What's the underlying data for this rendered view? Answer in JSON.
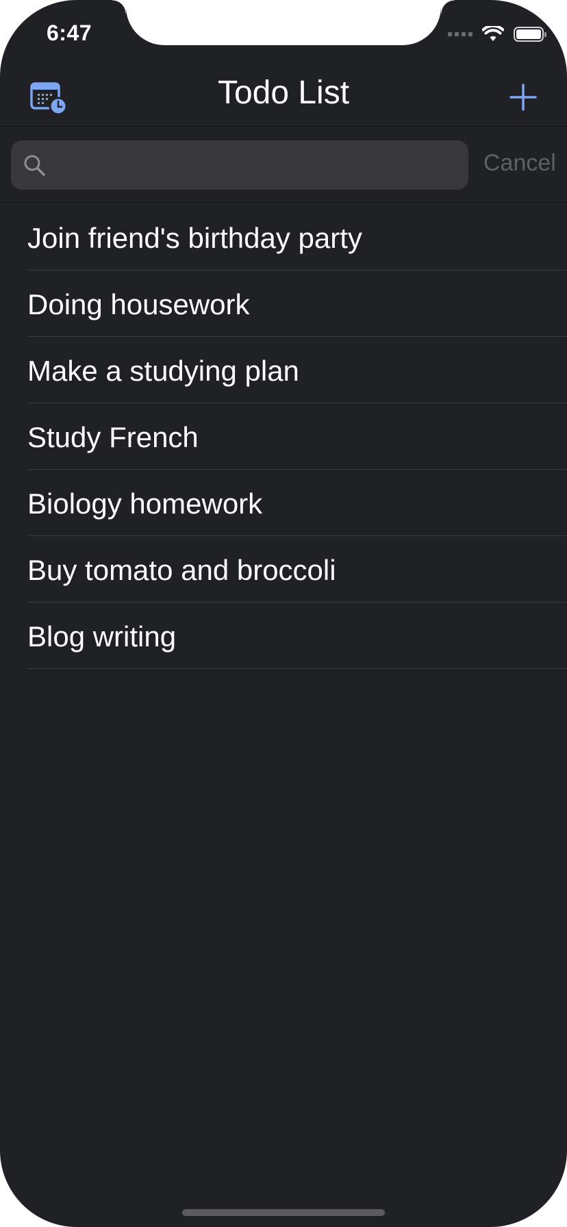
{
  "status_bar": {
    "time": "6:47"
  },
  "navbar": {
    "title": "Todo List",
    "calendar_icon": "calendar-clock-icon",
    "add_icon": "plus-icon"
  },
  "search": {
    "placeholder": "",
    "value": "",
    "cancel_label": "Cancel"
  },
  "todos": [
    {
      "label": "Join friend's birthday party"
    },
    {
      "label": "Doing housework"
    },
    {
      "label": "Make a studying plan"
    },
    {
      "label": "Study French"
    },
    {
      "label": "Biology homework"
    },
    {
      "label": "Buy tomato and broccoli"
    },
    {
      "label": "Blog writing"
    }
  ],
  "colors": {
    "background": "#202125",
    "accent": "#7ea6f2",
    "search_field": "#38383c",
    "separator": "#3b3c40",
    "cancel_text": "#5f6064"
  }
}
